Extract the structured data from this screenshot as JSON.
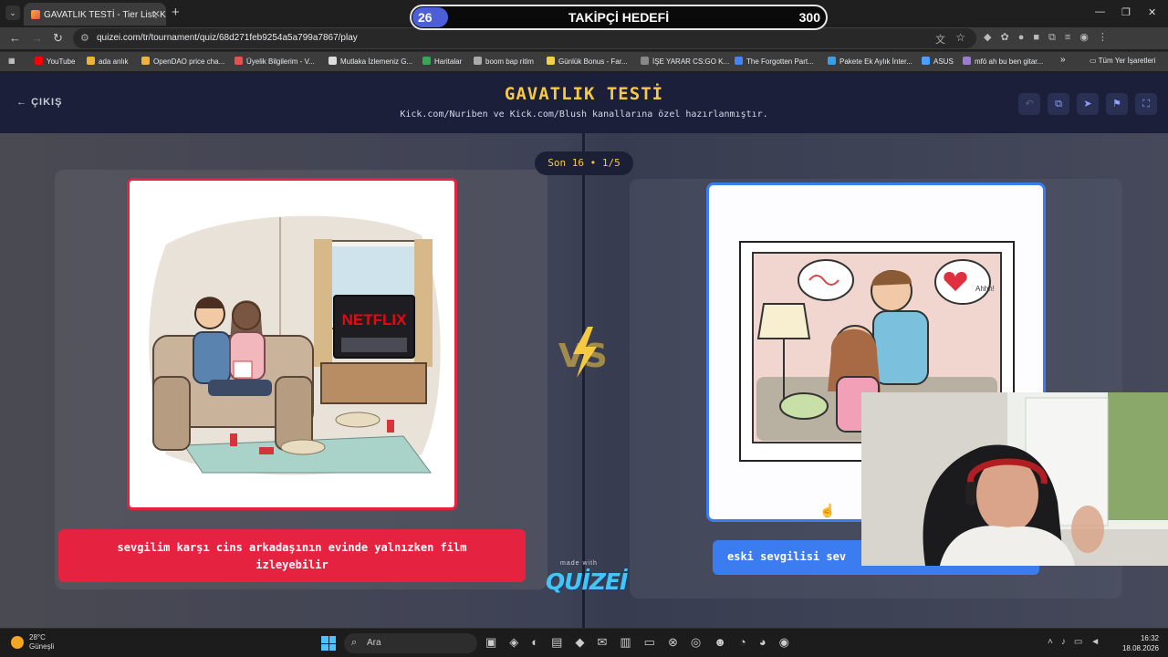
{
  "browser": {
    "tab_title": "GAVATLIK TESTİ - Tier List, Kör S",
    "url": "quizei.com/tr/tournament/quiz/68d271feb9254a5a799a7867/play",
    "bookmarks": [
      {
        "label": "YouTube",
        "color": "#ff0000"
      },
      {
        "label": "ada anlık",
        "color": "#f2b233"
      },
      {
        "label": "OpenDAO price cha...",
        "color": "#f2b233"
      },
      {
        "label": "Üyelik Bilgilerim - V...",
        "color": "#e8514b"
      },
      {
        "label": "Mutlaka İzlemeniz G...",
        "color": "#dddddd"
      },
      {
        "label": "Haritalar",
        "color": "#34a853"
      },
      {
        "label": "boom bap ritim",
        "color": "#aaaaaa"
      },
      {
        "label": "Günlük Bonus - Far...",
        "color": "#f5d142"
      },
      {
        "label": "İŞE YARAR CS:GO K...",
        "color": "#888888"
      },
      {
        "label": "The Forgotten Part...",
        "color": "#4285f4"
      },
      {
        "label": "Pakete Ek Aylık İnter...",
        "color": "#34a0f0"
      },
      {
        "label": "ASUS",
        "color": "#4aa0ff"
      },
      {
        "label": "mfö ah bu ben gitar...",
        "color": "#9c7bd8"
      }
    ],
    "bookmarks_all": "Tüm Yer İşaretleri"
  },
  "goal_overlay": {
    "current": "26",
    "label": "TAKİPÇİ HEDEFİ",
    "target": "300",
    "progress": 0.087
  },
  "header": {
    "exit_label": "ÇIKIŞ",
    "title": "GAVATLIK TESTİ",
    "subtitle": "Kick.com/Nuriben ve Kick.com/Blush kanallarına özel hazırlanmıştır."
  },
  "round": {
    "label": "Son 16 • 1/5"
  },
  "options": {
    "left": {
      "caption": "sevgilim karşı cins arkadaşının evinde yalnızken film izleyebilir",
      "tv_text": "NETFLIX"
    },
    "right": {
      "caption": "eski sevgilisi sev",
      "bubble_text": "Ahhh!"
    }
  },
  "branding": {
    "made_with": "made with",
    "logo": "QUİZEİ"
  },
  "taskbar": {
    "temperature": "28°C",
    "weather": "Güneşli",
    "search_placeholder": "Ara",
    "time": "16:32",
    "date": "18.08.2026"
  },
  "colors": {
    "accent_yellow": "#f6c945",
    "left_red": "#e5223f",
    "right_blue": "#3b7cf0",
    "header_bg": "#1b1f3a"
  }
}
